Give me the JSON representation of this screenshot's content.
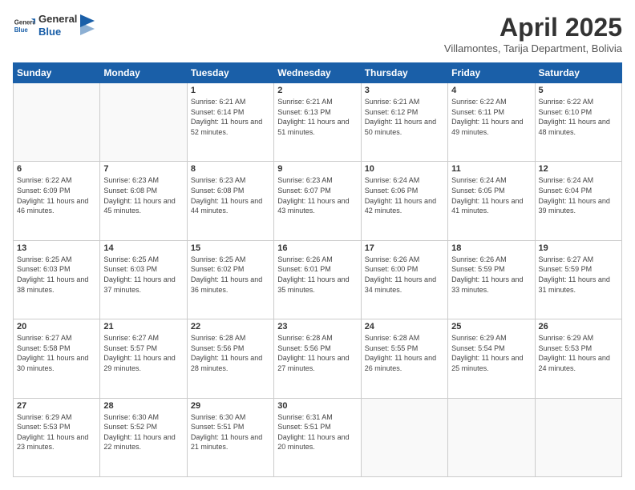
{
  "logo": {
    "general": "General",
    "blue": "Blue"
  },
  "title": {
    "month": "April 2025",
    "location": "Villamontes, Tarija Department, Bolivia"
  },
  "weekdays": [
    "Sunday",
    "Monday",
    "Tuesday",
    "Wednesday",
    "Thursday",
    "Friday",
    "Saturday"
  ],
  "weeks": [
    [
      {
        "num": "",
        "empty": true
      },
      {
        "num": "",
        "empty": true
      },
      {
        "num": "1",
        "sunrise": "6:21 AM",
        "sunset": "6:14 PM",
        "daylight": "11 hours and 52 minutes."
      },
      {
        "num": "2",
        "sunrise": "6:21 AM",
        "sunset": "6:13 PM",
        "daylight": "11 hours and 51 minutes."
      },
      {
        "num": "3",
        "sunrise": "6:21 AM",
        "sunset": "6:12 PM",
        "daylight": "11 hours and 50 minutes."
      },
      {
        "num": "4",
        "sunrise": "6:22 AM",
        "sunset": "6:11 PM",
        "daylight": "11 hours and 49 minutes."
      },
      {
        "num": "5",
        "sunrise": "6:22 AM",
        "sunset": "6:10 PM",
        "daylight": "11 hours and 48 minutes."
      }
    ],
    [
      {
        "num": "6",
        "sunrise": "6:22 AM",
        "sunset": "6:09 PM",
        "daylight": "11 hours and 46 minutes."
      },
      {
        "num": "7",
        "sunrise": "6:23 AM",
        "sunset": "6:08 PM",
        "daylight": "11 hours and 45 minutes."
      },
      {
        "num": "8",
        "sunrise": "6:23 AM",
        "sunset": "6:08 PM",
        "daylight": "11 hours and 44 minutes."
      },
      {
        "num": "9",
        "sunrise": "6:23 AM",
        "sunset": "6:07 PM",
        "daylight": "11 hours and 43 minutes."
      },
      {
        "num": "10",
        "sunrise": "6:24 AM",
        "sunset": "6:06 PM",
        "daylight": "11 hours and 42 minutes."
      },
      {
        "num": "11",
        "sunrise": "6:24 AM",
        "sunset": "6:05 PM",
        "daylight": "11 hours and 41 minutes."
      },
      {
        "num": "12",
        "sunrise": "6:24 AM",
        "sunset": "6:04 PM",
        "daylight": "11 hours and 39 minutes."
      }
    ],
    [
      {
        "num": "13",
        "sunrise": "6:25 AM",
        "sunset": "6:03 PM",
        "daylight": "11 hours and 38 minutes."
      },
      {
        "num": "14",
        "sunrise": "6:25 AM",
        "sunset": "6:03 PM",
        "daylight": "11 hours and 37 minutes."
      },
      {
        "num": "15",
        "sunrise": "6:25 AM",
        "sunset": "6:02 PM",
        "daylight": "11 hours and 36 minutes."
      },
      {
        "num": "16",
        "sunrise": "6:26 AM",
        "sunset": "6:01 PM",
        "daylight": "11 hours and 35 minutes."
      },
      {
        "num": "17",
        "sunrise": "6:26 AM",
        "sunset": "6:00 PM",
        "daylight": "11 hours and 34 minutes."
      },
      {
        "num": "18",
        "sunrise": "6:26 AM",
        "sunset": "5:59 PM",
        "daylight": "11 hours and 33 minutes."
      },
      {
        "num": "19",
        "sunrise": "6:27 AM",
        "sunset": "5:59 PM",
        "daylight": "11 hours and 31 minutes."
      }
    ],
    [
      {
        "num": "20",
        "sunrise": "6:27 AM",
        "sunset": "5:58 PM",
        "daylight": "11 hours and 30 minutes."
      },
      {
        "num": "21",
        "sunrise": "6:27 AM",
        "sunset": "5:57 PM",
        "daylight": "11 hours and 29 minutes."
      },
      {
        "num": "22",
        "sunrise": "6:28 AM",
        "sunset": "5:56 PM",
        "daylight": "11 hours and 28 minutes."
      },
      {
        "num": "23",
        "sunrise": "6:28 AM",
        "sunset": "5:56 PM",
        "daylight": "11 hours and 27 minutes."
      },
      {
        "num": "24",
        "sunrise": "6:28 AM",
        "sunset": "5:55 PM",
        "daylight": "11 hours and 26 minutes."
      },
      {
        "num": "25",
        "sunrise": "6:29 AM",
        "sunset": "5:54 PM",
        "daylight": "11 hours and 25 minutes."
      },
      {
        "num": "26",
        "sunrise": "6:29 AM",
        "sunset": "5:53 PM",
        "daylight": "11 hours and 24 minutes."
      }
    ],
    [
      {
        "num": "27",
        "sunrise": "6:29 AM",
        "sunset": "5:53 PM",
        "daylight": "11 hours and 23 minutes."
      },
      {
        "num": "28",
        "sunrise": "6:30 AM",
        "sunset": "5:52 PM",
        "daylight": "11 hours and 22 minutes."
      },
      {
        "num": "29",
        "sunrise": "6:30 AM",
        "sunset": "5:51 PM",
        "daylight": "11 hours and 21 minutes."
      },
      {
        "num": "30",
        "sunrise": "6:31 AM",
        "sunset": "5:51 PM",
        "daylight": "11 hours and 20 minutes."
      },
      {
        "num": "",
        "empty": true
      },
      {
        "num": "",
        "empty": true
      },
      {
        "num": "",
        "empty": true
      }
    ]
  ],
  "labels": {
    "sunrise_prefix": "Sunrise: ",
    "sunset_prefix": "Sunset: ",
    "daylight_prefix": "Daylight: "
  }
}
